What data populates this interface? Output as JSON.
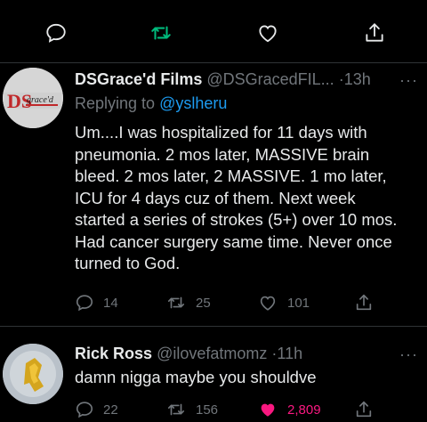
{
  "top_actions": [
    "reply-icon",
    "retweet-icon",
    "like-icon",
    "share-icon"
  ],
  "colors": {
    "accent_blue": "#1d9bf0",
    "retweet_green": "#00ba7c",
    "like_pink": "#f91880",
    "muted": "#71767b"
  },
  "tweets": [
    {
      "avatar_text": "DSgrace'd",
      "name": "DSGrace'd Films",
      "handle": "@DSGracedFIL...",
      "dot": "·",
      "time": "13h",
      "more": "···",
      "replying_prefix": "Replying to",
      "replying_handle": "@yslheru",
      "lines": [
        "Um....I was hospitalized for 11 days with",
        "pneumonia. 2 mos later, MASSIVE brain",
        "bleed. 2 mos later, 2 MASSIVE.  1 mo later,",
        "ICU for 4 days cuz of them.  Next week",
        "started a series of strokes (5+) over 10 mos.",
        "Had cancer surgery same time. Never once",
        "turned to God."
      ],
      "stats": {
        "replies": "14",
        "retweets": "25",
        "likes": "101"
      }
    },
    {
      "name": "Rick Ross",
      "handle": "@ilovefatmomz",
      "dot": "·",
      "time": "11h",
      "more": "···",
      "lines": [
        "damn nigga maybe you shouldve"
      ],
      "stats": {
        "replies": "22",
        "retweets": "156",
        "likes": "2,809"
      }
    }
  ]
}
